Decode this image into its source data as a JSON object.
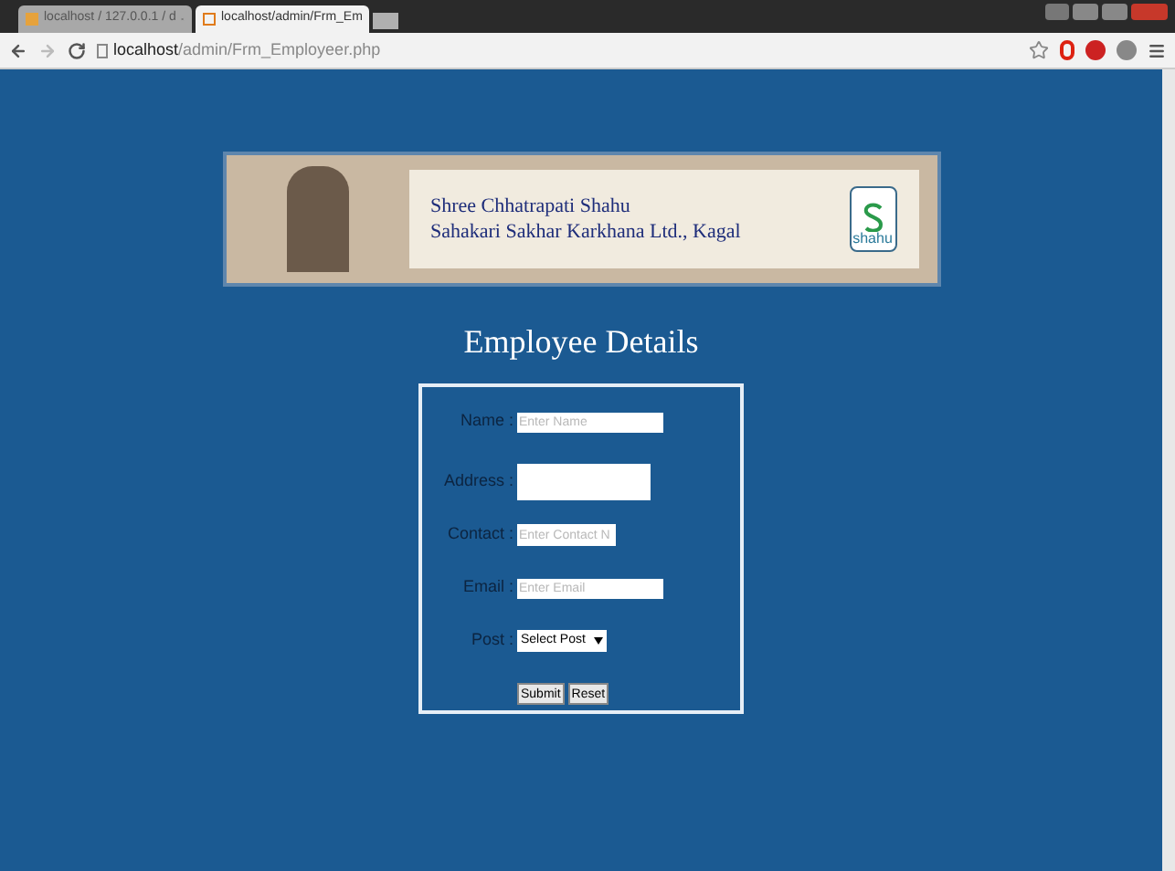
{
  "browser": {
    "tabs": [
      {
        "title": "localhost / 127.0.0.1 / d",
        "selected": false
      },
      {
        "title": "localhost/admin/Frm_Em",
        "selected": true
      }
    ],
    "url_host": "localhost",
    "url_path": "/admin/Frm_Employeer.php"
  },
  "banner": {
    "lines": [
      "Shree Chhatrapati Shahu",
      "Sahakari Sakhar Karkhana Ltd., Kagal"
    ],
    "logo_text": "shahu"
  },
  "heading": "Employee Details",
  "form": {
    "fields": [
      {
        "kind": "text",
        "label": "Name :",
        "placeholder": "Enter Name"
      },
      {
        "kind": "textarea",
        "label": "Address :"
      },
      {
        "kind": "short",
        "label": "Contact :",
        "placeholder": "Enter Contact N"
      },
      {
        "kind": "text",
        "label": "Email :",
        "placeholder": "Enter Email"
      },
      {
        "kind": "select",
        "label": "Post :",
        "value": "Select Post"
      }
    ],
    "buttons": [
      "Submit",
      "Reset"
    ]
  }
}
